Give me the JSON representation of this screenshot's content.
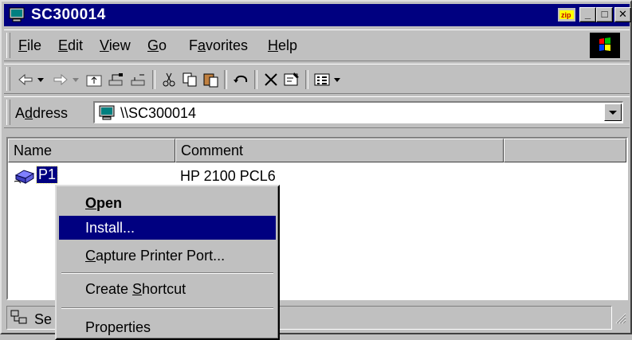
{
  "window": {
    "title": "SC300014",
    "controls": {
      "minimize": "_",
      "maximize": "□",
      "close": "✕"
    },
    "zip_badge": "zip"
  },
  "menubar": {
    "items": [
      {
        "label": "File",
        "accel": "F",
        "rest": "ile"
      },
      {
        "label": "Edit",
        "accel": "E",
        "rest": "dit"
      },
      {
        "label": "View",
        "accel": "V",
        "rest": "iew"
      },
      {
        "label": "Go",
        "accel": "G",
        "rest": "o"
      },
      {
        "label": "Favorites",
        "pre": "F",
        "accel": "a",
        "rest": "vorites"
      },
      {
        "label": "Help",
        "accel": "H",
        "rest": "elp"
      }
    ]
  },
  "toolbar": {
    "buttons": [
      "back-icon",
      "forward-icon",
      "up-folder-icon",
      "map-drive-icon",
      "disconnect-drive-icon",
      "cut-icon",
      "copy-icon",
      "paste-icon",
      "undo-icon",
      "delete-icon",
      "properties-icon",
      "views-icon"
    ]
  },
  "address": {
    "label_accel": "d",
    "label_pre": "A",
    "label_rest": "dress",
    "value": "\\\\SC300014"
  },
  "list": {
    "columns": [
      "Name",
      "Comment"
    ],
    "rows": [
      {
        "name": "P1",
        "comment": "HP 2100 PCL6",
        "icon": "printer-icon"
      }
    ]
  },
  "statusbar": {
    "text": "Se"
  },
  "context_menu": {
    "items": [
      {
        "label": "Open",
        "accel": "O",
        "rest": "pen",
        "bold": true
      },
      {
        "label": "Install...",
        "highlighted": true
      },
      {
        "label": "Capture Printer Port...",
        "accel": "C",
        "rest": "apture Printer Port..."
      },
      {
        "label": "Create Shortcut",
        "pre": "Create ",
        "accel": "S",
        "rest": "hortcut"
      },
      {
        "label": "Properties"
      }
    ]
  },
  "colors": {
    "titlebar": "#000080",
    "face": "#c0c0c0",
    "highlight": "#000080"
  }
}
